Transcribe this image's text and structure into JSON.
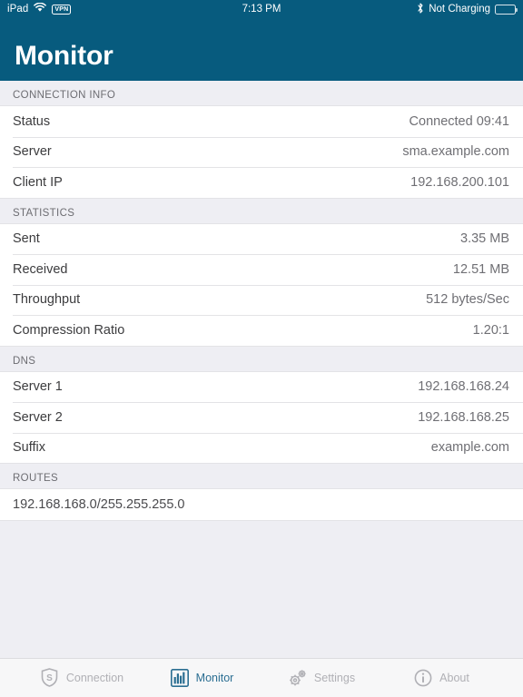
{
  "status_bar": {
    "device": "iPad",
    "wifi_icon": "wifi-icon",
    "vpn_badge": "VPN",
    "time": "7:13 PM",
    "bluetooth_icon": "bluetooth-icon",
    "battery_text": "Not Charging",
    "battery_icon": "battery-icon"
  },
  "nav": {
    "title": "Monitor",
    "background": "#075b7e"
  },
  "sections": [
    {
      "header": "CONNECTION INFO",
      "rows": [
        {
          "label": "Status",
          "value": "Connected 09:41"
        },
        {
          "label": "Server",
          "value": "sma.example.com"
        },
        {
          "label": "Client IP",
          "value": "192.168.200.101"
        }
      ]
    },
    {
      "header": "STATISTICS",
      "rows": [
        {
          "label": "Sent",
          "value": "3.35 MB"
        },
        {
          "label": "Received",
          "value": "12.51 MB"
        },
        {
          "label": "Throughput",
          "value": "512 bytes/Sec"
        },
        {
          "label": "Compression Ratio",
          "value": "1.20:1"
        }
      ]
    },
    {
      "header": "DNS",
      "rows": [
        {
          "label": "Server 1",
          "value": "192.168.168.24"
        },
        {
          "label": "Server 2",
          "value": "192.168.168.25"
        },
        {
          "label": "Suffix",
          "value": "example.com"
        }
      ]
    },
    {
      "header": "ROUTES",
      "rows": [
        {
          "label": "192.168.168.0/255.255.255.0",
          "value": ""
        }
      ]
    }
  ],
  "tabs": [
    {
      "label": "Connection",
      "icon": "shield-s-icon",
      "selected": false
    },
    {
      "label": "Monitor",
      "icon": "bar-chart-icon",
      "selected": true
    },
    {
      "label": "Settings",
      "icon": "gears-icon",
      "selected": false
    },
    {
      "label": "About",
      "icon": "info-circle-icon",
      "selected": false
    }
  ],
  "colors": {
    "accent": "#075b7e",
    "tab_selected": "#2b6e92",
    "tab_inactive": "#b0b0b5",
    "group_background": "#eeeef3",
    "row_background": "#ffffff",
    "separator": "#e3e3e6"
  }
}
